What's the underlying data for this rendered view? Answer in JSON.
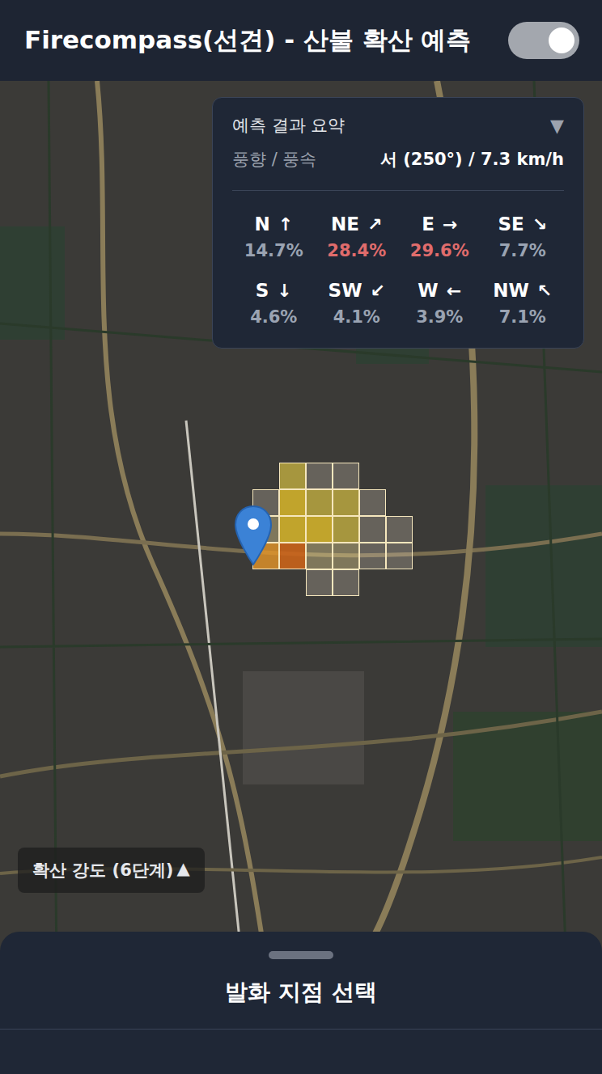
{
  "header": {
    "title": "Firecompass(선견) - 산불 확산 예측",
    "toggle": {
      "on": true
    }
  },
  "summary": {
    "title": "예측 결과 요약",
    "collapse_icon": "▼",
    "wind_label": "풍향 / 풍속",
    "wind_value": "서 (250°) / 7.3 km/h",
    "directions": [
      {
        "label": "N",
        "arrow": "↑",
        "percent": "14.7%",
        "highlighted": false
      },
      {
        "label": "NE",
        "arrow": "↗",
        "percent": "28.4%",
        "highlighted": true
      },
      {
        "label": "E",
        "arrow": "→",
        "percent": "29.6%",
        "highlighted": true
      },
      {
        "label": "SE",
        "arrow": "↘",
        "percent": "7.7%",
        "highlighted": false
      },
      {
        "label": "S",
        "arrow": "↓",
        "percent": "4.6%",
        "highlighted": false
      },
      {
        "label": "SW",
        "arrow": "↙",
        "percent": "4.1%",
        "highlighted": false
      },
      {
        "label": "W",
        "arrow": "←",
        "percent": "3.9%",
        "highlighted": false
      },
      {
        "label": "NW",
        "arrow": "↖",
        "percent": "7.1%",
        "highlighted": false
      }
    ]
  },
  "spread_grid": {
    "levels": [
      [
        0,
        3,
        1,
        1,
        0,
        0
      ],
      [
        1,
        4,
        3,
        3,
        1,
        0
      ],
      [
        2,
        4,
        4,
        3,
        1,
        1
      ],
      [
        5,
        6,
        2,
        2,
        1,
        1
      ],
      [
        0,
        0,
        1,
        1,
        0,
        0
      ]
    ]
  },
  "legend": {
    "label": "확산 강도 (6단계)",
    "expand_icon": "▲",
    "expanded": false
  },
  "bottom_sheet": {
    "title": "발화 지점 선택"
  }
}
